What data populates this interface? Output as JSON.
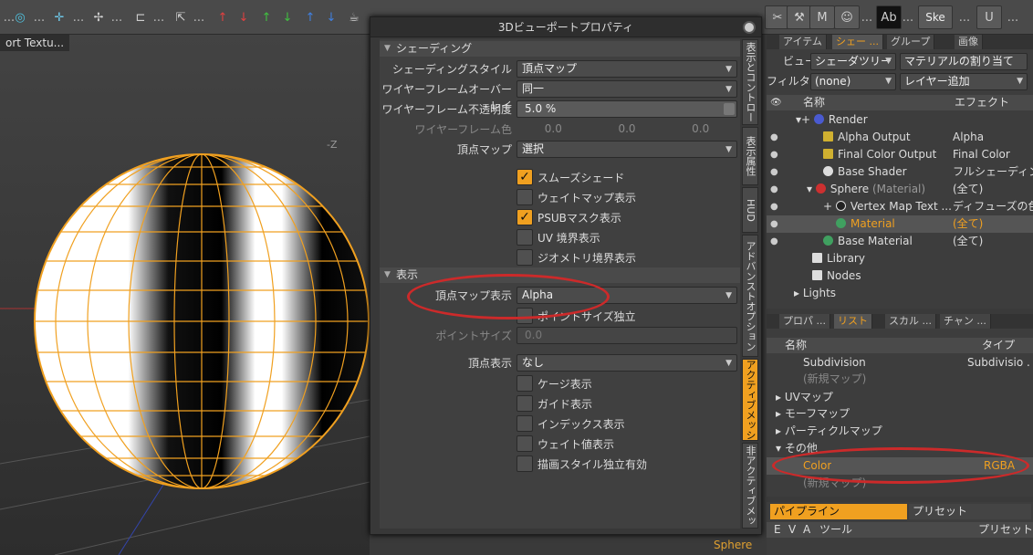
{
  "toolbar": {
    "dots": "...",
    "skel_label": "Ske",
    "icons": [
      "circle-target-icon",
      "crosshair-icon",
      "fan-icon",
      "snap-icon",
      "select-icon",
      "arrow-up-red-icon",
      "arrow-down-red-icon",
      "arrow-up-green-icon",
      "arrow-down-green-icon",
      "arrow-up-blue-icon",
      "arrow-down-blue-icon",
      "teapot-icon",
      "scissors-icon",
      "hammer-icon",
      "m-icon",
      "face-icon",
      "ab-icon",
      "unreal-icon"
    ]
  },
  "viewport": {
    "tab_label": "ort Textu...",
    "axis_label": "-Z",
    "selection_label": "Sphere"
  },
  "dialog": {
    "title": "3Dビューポートプロパティ",
    "shading_section": "シェーディング",
    "shading_style_label": "シェーディングスタイル",
    "shading_style_value": "頂点マップ",
    "wire_overlay_label": "ワイヤーフレームオーバーレイ",
    "wire_overlay_value": "同一",
    "wire_opacity_label": "ワイヤーフレーム不透明度",
    "wire_opacity_value": "5.0 %",
    "wire_color_label": "ワイヤーフレーム色",
    "wire_color_values": [
      "0.0",
      "0.0",
      "0.0"
    ],
    "vertex_map_label": "頂点マップ",
    "vertex_map_value": "選択",
    "cb_smooth": "スムーズシェード",
    "cb_weight": "ウェイトマップ表示",
    "cb_psub": "PSUBマスク表示",
    "cb_uv": "UV 境界表示",
    "cb_geo": "ジオメトリ境界表示",
    "display_section": "表示",
    "vmap_display_label": "頂点マップ表示",
    "vmap_display_value": "Alpha",
    "cb_pointsize": "ポイントサイズ独立",
    "point_size_label": "ポイントサイズ",
    "point_size_value": "0.0",
    "vertex_display_label": "頂点表示",
    "vertex_display_value": "なし",
    "cb_cage": "ケージ表示",
    "cb_guide": "ガイド表示",
    "cb_index": "インデックス表示",
    "cb_weightval": "ウェイト値表示",
    "cb_drawstyle": "描画スタイル独立有効",
    "vtabs": [
      "表示とコントロール",
      "表示属性",
      "HUD",
      "アドバンストオプション",
      "アクティブメッシュ",
      "非アクティブメッシュ"
    ]
  },
  "shader_panel": {
    "tabs": [
      "アイテム",
      "シェー ...",
      "グループ",
      "画像"
    ],
    "view_label": "ビュー",
    "view_value": "シェーダツリー",
    "assign_button": "マテリアルの割り当て",
    "filter_label": "フィルター",
    "filter_value": "(none)",
    "add_layer": "レイヤー追加",
    "col_name": "名称",
    "col_effect": "エフェクト",
    "rows": [
      {
        "name": "Render",
        "effect": ""
      },
      {
        "name": "Alpha Output",
        "effect": "Alpha"
      },
      {
        "name": "Final Color Output",
        "effect": "Final Color"
      },
      {
        "name": "Base Shader",
        "effect": "フルシェーディン..."
      },
      {
        "name": "Sphere",
        "suffix": "(Material)",
        "effect": "(全て)"
      },
      {
        "name": "Vertex Map Text ...",
        "effect": "ディフューズの色"
      },
      {
        "name": "Material",
        "effect": "(全て)"
      },
      {
        "name": "Base Material",
        "effect": "(全て)"
      },
      {
        "name": "Library",
        "effect": ""
      },
      {
        "name": "Nodes",
        "effect": ""
      },
      {
        "name": "Lights",
        "effect": ""
      }
    ]
  },
  "list_panel": {
    "tabs": [
      "プロパ ...",
      "リスト",
      "スカル ...",
      "チャン ..."
    ],
    "col_name": "名称",
    "col_type": "タイプ",
    "rows": [
      {
        "name": "Subdivision",
        "type": "Subdivisio ..."
      },
      {
        "name": "(新規マップ)",
        "type": ""
      },
      {
        "name": "UVマップ",
        "type": ""
      },
      {
        "name": "モーフマップ",
        "type": ""
      },
      {
        "name": "パーティクルマップ",
        "type": ""
      },
      {
        "name": "その他",
        "type": ""
      },
      {
        "name": "Color",
        "type": "RGBA"
      },
      {
        "name": "(新規マップ)",
        "type": ""
      }
    ]
  },
  "pipeline_panel": {
    "tab_pipeline": "パイプライン",
    "tab_preset": "プリセット",
    "cols": [
      "E",
      "V",
      "A",
      "ツール",
      "プリセット"
    ]
  },
  "colors": {
    "accent": "#f0a020",
    "annotation": "#cc2a2a"
  }
}
